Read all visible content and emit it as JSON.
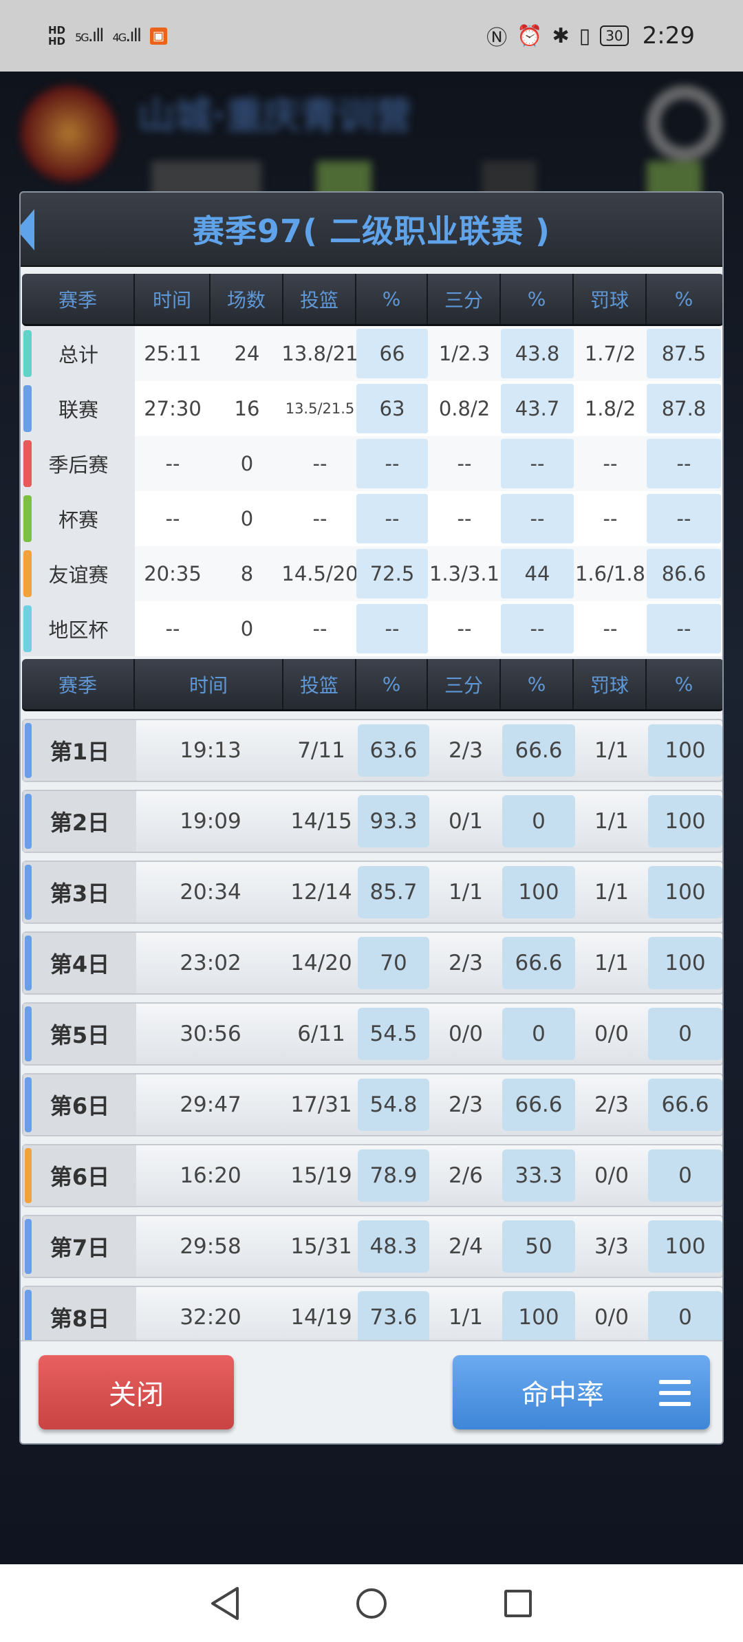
{
  "status_bar": {
    "hd1": "HD",
    "hd2": "HD",
    "net1": "5G",
    "net2": "4G",
    "battery": "30",
    "time": "2:29"
  },
  "background": {
    "title": "山城·重庆青训营"
  },
  "dialog": {
    "title": "赛季97( 二级职业联赛 )",
    "summary_header": [
      "赛季",
      "时间",
      "场数",
      "投篮",
      "%",
      "三分",
      "%",
      "罚球",
      "%"
    ],
    "summary_rows": [
      {
        "label": "总计",
        "time": "25:11",
        "games": "24",
        "fg": "13.8/21",
        "fg_pct": "66",
        "three": "1/2.3",
        "three_pct": "43.8",
        "ft": "1.7/2",
        "ft_pct": "87.5",
        "color": "#5fd3c8"
      },
      {
        "label": "联赛",
        "time": "27:30",
        "games": "16",
        "fg": "13.5/21.5",
        "fg_pct": "63",
        "three": "0.8/2",
        "three_pct": "43.7",
        "ft": "1.8/2",
        "ft_pct": "87.8",
        "color": "#6a9fe8"
      },
      {
        "label": "季后赛",
        "time": "--",
        "games": "0",
        "fg": "--",
        "fg_pct": "--",
        "three": "--",
        "three_pct": "--",
        "ft": "--",
        "ft_pct": "--",
        "color": "#e85a5a"
      },
      {
        "label": "杯赛",
        "time": "--",
        "games": "0",
        "fg": "--",
        "fg_pct": "--",
        "three": "--",
        "three_pct": "--",
        "ft": "--",
        "ft_pct": "--",
        "color": "#7bc043"
      },
      {
        "label": "友谊赛",
        "time": "20:35",
        "games": "8",
        "fg": "14.5/20",
        "fg_pct": "72.5",
        "three": "1.3/3.1",
        "three_pct": "44",
        "ft": "1.6/1.8",
        "ft_pct": "86.6",
        "color": "#f2a23a"
      },
      {
        "label": "地区杯",
        "time": "--",
        "games": "0",
        "fg": "--",
        "fg_pct": "--",
        "three": "--",
        "three_pct": "--",
        "ft": "--",
        "ft_pct": "--",
        "color": "#6fd0e0"
      }
    ],
    "daily_header": [
      "赛季",
      "时间",
      "投篮",
      "%",
      "三分",
      "%",
      "罚球",
      "%"
    ],
    "daily_rows": [
      {
        "label": "第1日",
        "time": "19:13",
        "fg": "7/11",
        "fg_pct": "63.6",
        "three": "2/3",
        "three_pct": "66.6",
        "ft": "1/1",
        "ft_pct": "100",
        "color": "#6a9fe8"
      },
      {
        "label": "第2日",
        "time": "19:09",
        "fg": "14/15",
        "fg_pct": "93.3",
        "three": "0/1",
        "three_pct": "0",
        "ft": "1/1",
        "ft_pct": "100",
        "color": "#6a9fe8"
      },
      {
        "label": "第3日",
        "time": "20:34",
        "fg": "12/14",
        "fg_pct": "85.7",
        "three": "1/1",
        "three_pct": "100",
        "ft": "1/1",
        "ft_pct": "100",
        "color": "#6a9fe8"
      },
      {
        "label": "第4日",
        "time": "23:02",
        "fg": "14/20",
        "fg_pct": "70",
        "three": "2/3",
        "three_pct": "66.6",
        "ft": "1/1",
        "ft_pct": "100",
        "color": "#6a9fe8"
      },
      {
        "label": "第5日",
        "time": "30:56",
        "fg": "6/11",
        "fg_pct": "54.5",
        "three": "0/0",
        "three_pct": "0",
        "ft": "0/0",
        "ft_pct": "0",
        "color": "#6a9fe8"
      },
      {
        "label": "第6日",
        "time": "29:47",
        "fg": "17/31",
        "fg_pct": "54.8",
        "three": "2/3",
        "three_pct": "66.6",
        "ft": "2/3",
        "ft_pct": "66.6",
        "color": "#6a9fe8"
      },
      {
        "label": "第6日",
        "time": "16:20",
        "fg": "15/19",
        "fg_pct": "78.9",
        "three": "2/6",
        "three_pct": "33.3",
        "ft": "0/0",
        "ft_pct": "0",
        "color": "#f2a23a"
      },
      {
        "label": "第7日",
        "time": "29:58",
        "fg": "15/31",
        "fg_pct": "48.3",
        "three": "2/4",
        "three_pct": "50",
        "ft": "3/3",
        "ft_pct": "100",
        "color": "#6a9fe8"
      },
      {
        "label": "第8日",
        "time": "32:20",
        "fg": "14/19",
        "fg_pct": "73.6",
        "three": "1/1",
        "three_pct": "100",
        "ft": "0/0",
        "ft_pct": "0",
        "color": "#6a9fe8"
      }
    ],
    "close_label": "关闭",
    "rate_label": "命中率"
  }
}
